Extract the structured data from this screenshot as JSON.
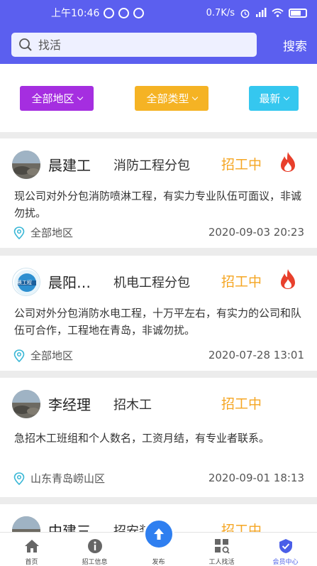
{
  "status_bar": {
    "time": "上午10:46",
    "network_speed": "0.7K/s"
  },
  "search": {
    "placeholder": "找活",
    "button_label": "搜索"
  },
  "filters": [
    {
      "label": "全部地区",
      "color": "#a52ee0"
    },
    {
      "label": "全部类型",
      "color": "#f5b324"
    },
    {
      "label": "最新",
      "color": "#35c7ef"
    }
  ],
  "posts": [
    {
      "name": "晨建工",
      "type": "消防工程分包",
      "status": "招工中",
      "hot": true,
      "description": "现公司对外分包消防喷淋工程，有实力专业队伍可面议，非诚勿扰。",
      "location": "全部地区",
      "time": "2020-09-03 20:23"
    },
    {
      "name": "晨阳…",
      "type": "机电工程分包",
      "status": "招工中",
      "hot": true,
      "description": "公司对外分包消防水电工程，十万平左右，有实力的公司和队伍可合作，工程地在青岛，非诚勿扰。",
      "location": "全部地区",
      "time": "2020-07-28 13:01",
      "avatar_text": "晨工程"
    },
    {
      "name": "李经理",
      "type": "招木工",
      "status": "招工中",
      "hot": false,
      "description": "急招木工班组和个人数名，工资月结，有专业者联系。",
      "location": "山东青岛崂山区",
      "time": "2020-09-01 18:13"
    },
    {
      "name": "中建三",
      "type": "招安装",
      "status": "招工中",
      "hot": false
    }
  ],
  "tabs": [
    {
      "label": "首页",
      "icon": "home-icon"
    },
    {
      "label": "招工信息",
      "icon": "info-icon"
    },
    {
      "label": "发布",
      "icon": "upload-icon"
    },
    {
      "label": "工人找活",
      "icon": "worker-search-icon"
    },
    {
      "label": "会员中心",
      "icon": "member-icon",
      "active": true
    }
  ],
  "colors": {
    "primary": "#5b5fef",
    "status": "#f5a623",
    "fire": "#e8402c",
    "tab_active": "#4a5ee8",
    "publish": "#2f7ff0"
  }
}
